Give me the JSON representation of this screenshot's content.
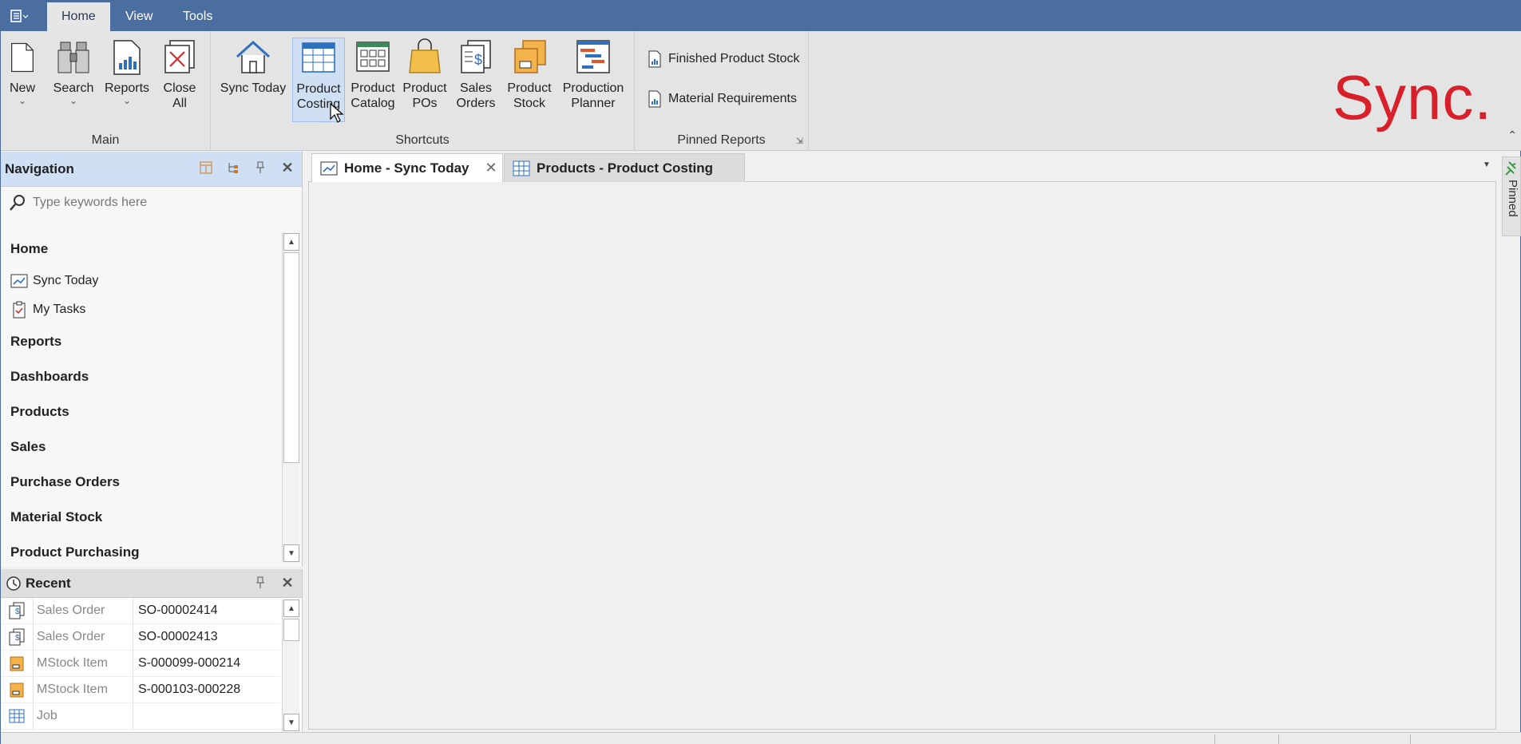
{
  "ribbon_tabs": [
    "Home",
    "View",
    "Tools"
  ],
  "groups": {
    "main": {
      "label": "Main",
      "buttons": [
        {
          "label": "New",
          "icon": "new-document-icon"
        },
        {
          "label": "Search",
          "icon": "binoculars-icon"
        },
        {
          "label": "Reports",
          "icon": "report-icon"
        },
        {
          "label": "Close All",
          "line1": "Close",
          "line2": "All",
          "icon": "close-window-icon"
        }
      ]
    },
    "shortcuts": {
      "label": "Shortcuts",
      "buttons": [
        {
          "label": "Sync Today",
          "icon": "home-icon"
        },
        {
          "line1": "Product",
          "line2": "Costing",
          "icon": "grid-table-icon"
        },
        {
          "line1": "Product",
          "line2": "Catalog",
          "icon": "catalog-icon"
        },
        {
          "line1": "Product",
          "line2": "POs",
          "icon": "shopping-bag-icon"
        },
        {
          "line1": "Sales",
          "line2": "Orders",
          "icon": "sales-order-icon"
        },
        {
          "line1": "Product",
          "line2": "Stock",
          "icon": "stock-box-icon"
        },
        {
          "line1": "Production",
          "line2": "Planner",
          "icon": "gantt-planner-icon"
        }
      ]
    },
    "pinned_reports": {
      "label": "Pinned Reports",
      "items": [
        "Finished Product Stock",
        "Material Requirements"
      ]
    }
  },
  "logo_text": "Sync.",
  "navigation": {
    "title": "Navigation",
    "search_placeholder": "Type keywords here",
    "home_label": "Home",
    "home_items": [
      "Sync Today",
      "My Tasks"
    ],
    "categories": [
      "Reports",
      "Dashboards",
      "Products",
      "Sales",
      "Purchase Orders",
      "Material Stock",
      "Product Purchasing"
    ]
  },
  "recent": {
    "title": "Recent",
    "rows": [
      {
        "type": "Sales Order",
        "value": "SO-00002414"
      },
      {
        "type": "Sales Order",
        "value": "SO-00002413"
      },
      {
        "type": "MStock Item",
        "value": "S-000099-000214"
      },
      {
        "type": "MStock Item",
        "value": "S-000103-000228"
      },
      {
        "type": "Job",
        "value": ""
      }
    ]
  },
  "document_tabs": [
    {
      "label": "Home - Sync Today",
      "active": true
    },
    {
      "label": "Products - Product Costing",
      "active": false
    }
  ],
  "side_panel": {
    "label": "Pinned"
  },
  "colors": {
    "accent": "#4b6ea0",
    "brand": "#d8202a",
    "highlight": "#cfe0f5"
  }
}
